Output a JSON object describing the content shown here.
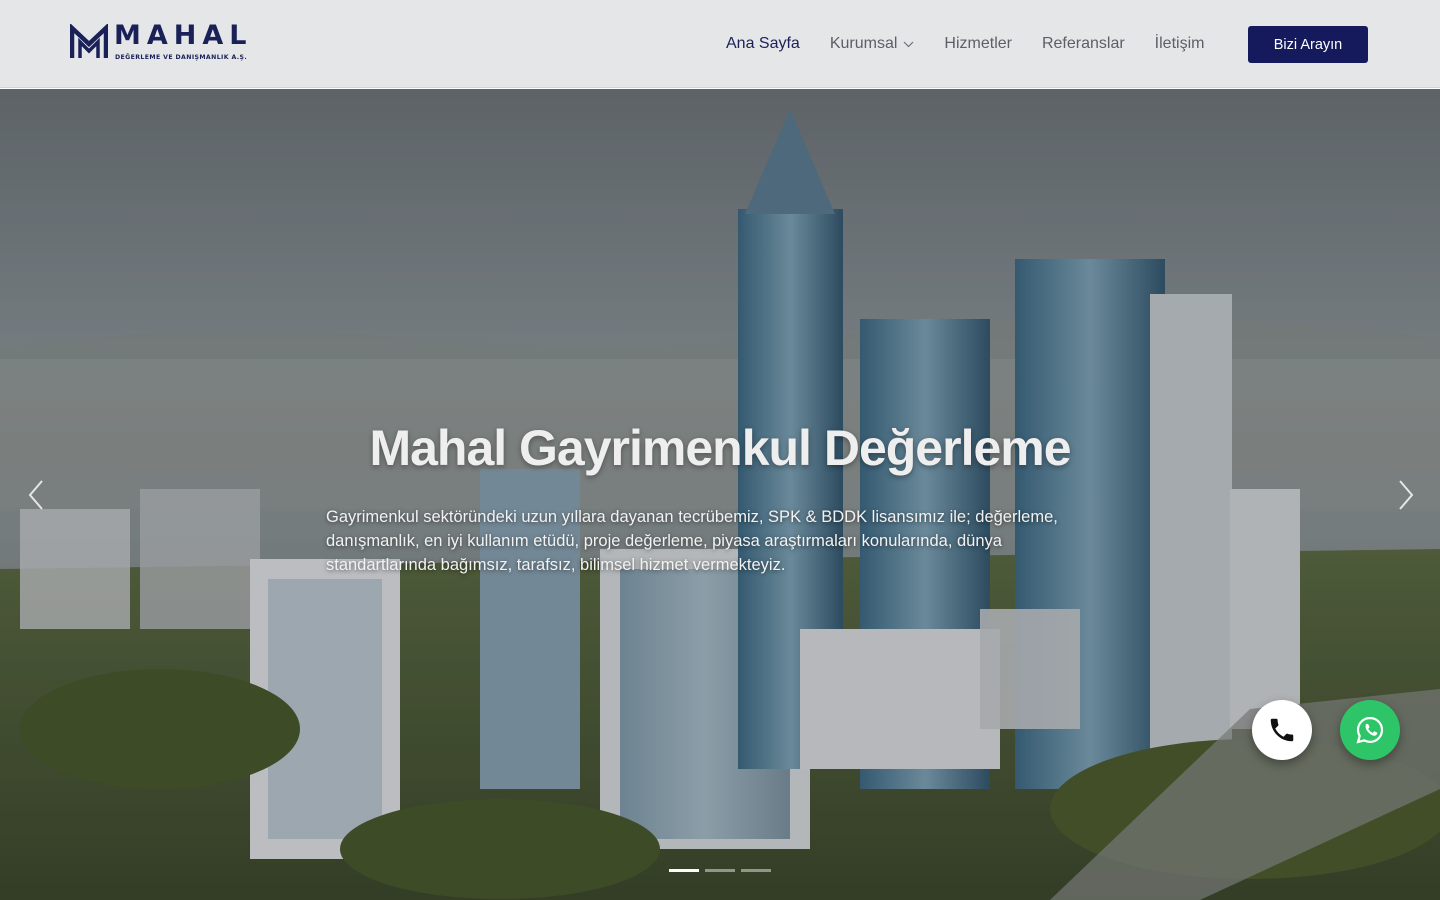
{
  "brand": {
    "name": "MAHAL",
    "tagline": "DEĞERLEME VE DANIŞMANLIK A.Ş.",
    "color": "#1a2158"
  },
  "nav": {
    "items": [
      {
        "label": "Ana Sayfa",
        "active": true
      },
      {
        "label": "Kurumsal",
        "has_dropdown": true
      },
      {
        "label": "Hizmetler"
      },
      {
        "label": "Referanslar"
      },
      {
        "label": "İletişim"
      }
    ],
    "cta_label": "Bizi Arayın",
    "cta_color": "#141a5c"
  },
  "hero": {
    "title": "Mahal Gayrimenkul Değerleme",
    "description": "Gayrimenkul sektöründeki uzun yıllara dayanan tecrübemiz, SPK & BDDK lisansımız ile; değerleme, danışmanlık, en iyi kullanım etüdü, proje değerleme, piyasa araştırmaları konularında, dünya standartlarında bağımsız, tarafsız, bilimsel hizmet vermekteyiz.",
    "slides_total": 3,
    "active_slide": 1
  },
  "floating": {
    "phone_icon": "phone-icon",
    "whatsapp_icon": "whatsapp-icon",
    "whatsapp_color": "#2dc567"
  }
}
